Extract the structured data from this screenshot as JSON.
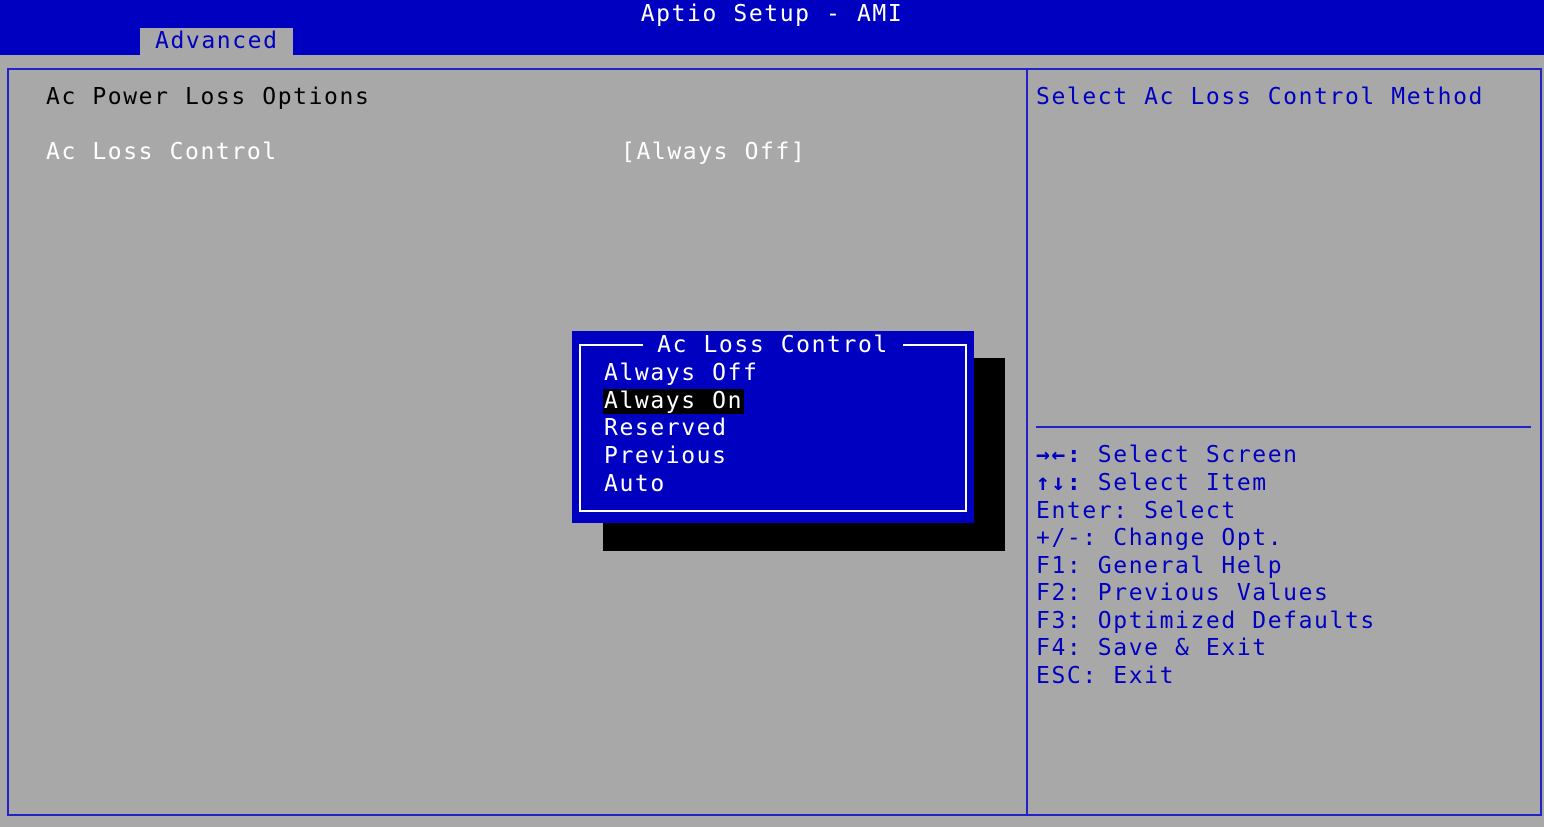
{
  "header": {
    "title": "Aptio Setup - AMI",
    "active_tab": "Advanced"
  },
  "main": {
    "section_title": "Ac Power Loss Options",
    "setting": {
      "label": "Ac Loss Control",
      "value": "[Always Off]"
    }
  },
  "help": {
    "description": "Select Ac Loss Control Method",
    "keys": [
      {
        "key": "→←:",
        "action": "Select Screen"
      },
      {
        "key": "↑↓:",
        "action": "Select Item"
      },
      {
        "key": "Enter:",
        "action": "Select"
      },
      {
        "key": "+/-:",
        "action": "Change Opt."
      },
      {
        "key": "F1:",
        "action": "General Help"
      },
      {
        "key": "F2:",
        "action": "Previous Values"
      },
      {
        "key": "F3:",
        "action": "Optimized Defaults"
      },
      {
        "key": "F4:",
        "action": "Save & Exit"
      },
      {
        "key": "ESC:",
        "action": "Exit"
      }
    ]
  },
  "popup": {
    "title": "Ac Loss Control",
    "options": [
      "Always Off",
      "Always On",
      "Reserved",
      "Previous",
      "Auto"
    ],
    "selected": "Always On"
  },
  "colors": {
    "bios_blue": "#0000c0",
    "background_gray": "#a8a8a8",
    "frame_blue": "#2222c8",
    "text_white": "#ffffff",
    "highlight_black": "#000000"
  }
}
